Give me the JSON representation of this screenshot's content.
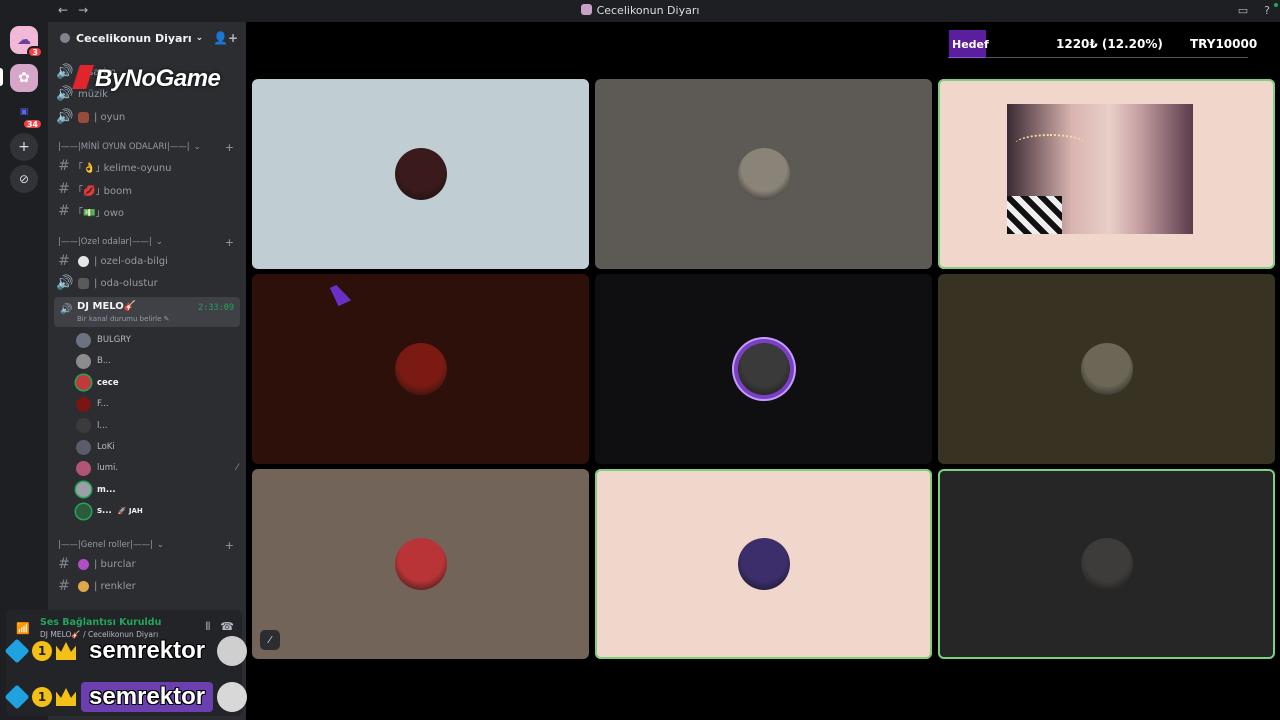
{
  "window": {
    "title": "Cecelikonun Diyarı"
  },
  "server": {
    "name": "Cecelikonun Diyarı"
  },
  "rail": {
    "badges": [
      "3",
      "34"
    ]
  },
  "logo": {
    "text": "ByNoGame"
  },
  "channels_top": [
    {
      "label": "tasarim",
      "type": "voice-partial"
    },
    {
      "label": "müzik",
      "type": "voice-partial"
    },
    {
      "label": "| oyun",
      "type": "voice"
    }
  ],
  "categories": [
    {
      "label": "|——|MİNİ OYUN ODALARI|——|",
      "channels": [
        "｢👌｣ kelime-oyunu",
        "｢💋｣ boom",
        "｢💵｣ owo"
      ]
    },
    {
      "label": "|——|Ozel odalar|——|",
      "channels": [
        "| ozel-oda-bilgi",
        "| oda-olustur"
      ]
    },
    {
      "label": "|——|Genel roller|——|",
      "channels": [
        "| burclar",
        "| renkler"
      ]
    }
  ],
  "voice_channel": {
    "name": "DJ MELO🎸",
    "status": "Bir kanal durumu belirle ✎",
    "timer": "2:33:09",
    "users": [
      {
        "name": "BULGRY",
        "color": "#6b7280",
        "talking": false,
        "bold": false
      },
      {
        "name": "B...",
        "color": "#8c8c8c",
        "talking": false,
        "bold": false
      },
      {
        "name": "cece",
        "color": "#c0393b",
        "talking": true,
        "bold": true
      },
      {
        "name": "F...",
        "color": "#7a1515",
        "talking": false,
        "bold": false
      },
      {
        "name": "l...",
        "color": "#3b3b3b",
        "talking": false,
        "bold": false
      },
      {
        "name": "LoKi",
        "color": "#5b5b6b",
        "talking": false,
        "bold": false
      },
      {
        "name": "lumi.",
        "color": "#b05575",
        "talking": false,
        "bold": false,
        "muted": true
      },
      {
        "name": "m...",
        "color": "#9aa0a6",
        "talking": true,
        "bold": true
      },
      {
        "name": "s...",
        "color": "#2d5a3a",
        "talking": true,
        "bold": true,
        "tag": "🚀 JAH"
      }
    ]
  },
  "connection": {
    "title": "Ses Bağlantısı Kuruldu",
    "subtitle": "DJ MELO🎸 / Cecelikonun Diyarı"
  },
  "overlay_names": [
    "semrektor",
    "semrektor"
  ],
  "goal": {
    "label": "Hedef",
    "progress_text": "1220₺ (12.20%)",
    "target_text": "TRY10000",
    "fraction": 0.122
  },
  "tiles": [
    {
      "bg": "#c0ced3",
      "avatar": "#3a1a1a",
      "speaking": false,
      "kind": "avatar"
    },
    {
      "bg": "#5d5955",
      "avatar": "#8a8378",
      "speaking": false,
      "kind": "avatar"
    },
    {
      "bg": "#f1d7cb",
      "avatar": "",
      "speaking": true,
      "kind": "camera"
    },
    {
      "bg": "#2d1009",
      "avatar": "#7a1a12",
      "speaking": false,
      "kind": "avatar"
    },
    {
      "bg": "#0f0e10",
      "avatar": "#3a3a3a",
      "speaking": false,
      "kind": "framed"
    },
    {
      "bg": "#373221",
      "avatar": "#6c6656",
      "speaking": false,
      "kind": "avatar"
    },
    {
      "bg": "#736459",
      "avatar": "#b83436",
      "speaking": false,
      "kind": "avatar"
    },
    {
      "bg": "#f1d7cb",
      "avatar": "#3b2e6b",
      "speaking": true,
      "kind": "avatar"
    },
    {
      "bg": "#262626",
      "avatar": "#3e3c3a",
      "speaking": true,
      "kind": "avatar"
    }
  ]
}
